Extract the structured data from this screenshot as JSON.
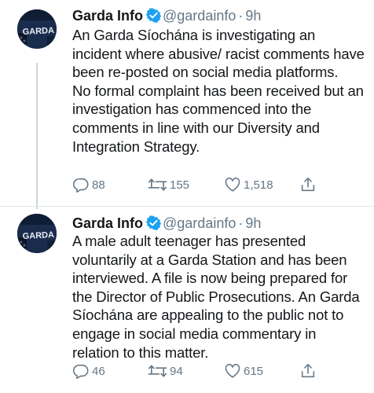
{
  "tweets": [
    {
      "author": "Garda Info",
      "handle": "@gardainfo",
      "separator": "·",
      "time": "9h",
      "avatar_text": "GARDA",
      "paragraphs": [
        "An Garda Síochána is investigating an incident where abusive/ racist comments have been re-posted on social media platforms.",
        "No formal complaint has been received but an investigation has commenced into the comments in line with our Diversity and Integration Strategy."
      ],
      "replies": "88",
      "retweets": "155",
      "likes": "1,518"
    },
    {
      "author": "Garda Info",
      "handle": "@gardainfo",
      "separator": "·",
      "time": "9h",
      "avatar_text": "GARDA",
      "paragraphs": [
        "A male adult teenager has presented voluntarily at a Garda Station and has been interviewed. A file is now being prepared for the Director of Public Prosecutions. An Garda Síochána are appealing to the public not to engage in social media commentary in relation to this matter."
      ],
      "replies": "46",
      "retweets": "94",
      "likes": "615"
    }
  ],
  "icons": {
    "verified": "verified-badge-icon",
    "reply": "reply-icon",
    "retweet": "retweet-icon",
    "like": "heart-icon",
    "share": "share-icon"
  },
  "colors": {
    "text": "#14171a",
    "secondary": "#657786",
    "verified": "#1da1f2",
    "thread_line": "#cdd5db",
    "avatar_bg": "#1d2f4f"
  }
}
